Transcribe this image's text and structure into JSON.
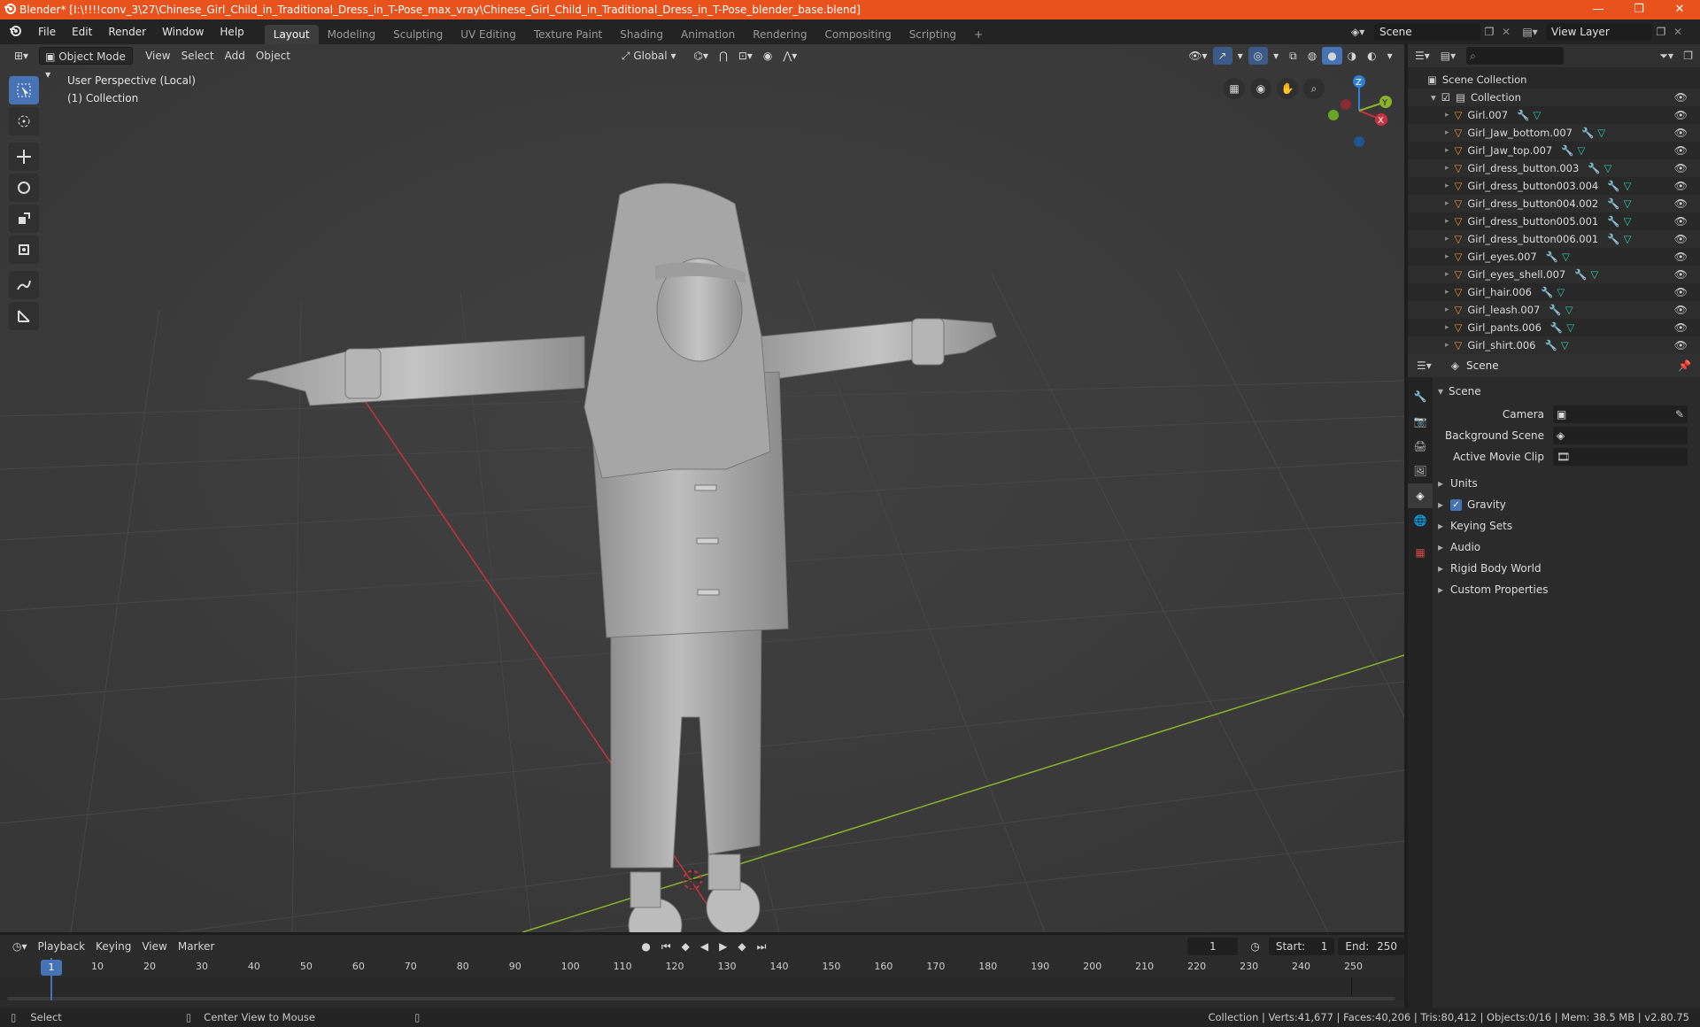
{
  "window": {
    "title": "Blender* [I:\\!!!!conv_3\\27\\Chinese_Girl_Child_in_Traditional_Dress_in_T-Pose_max_vray\\Chinese_Girl_Child_in_Traditional_Dress_in_T-Pose_blender_base.blend]",
    "minimize": "—",
    "maximize": "❐",
    "close": "✕"
  },
  "menubar": {
    "items": [
      "File",
      "Edit",
      "Render",
      "Window",
      "Help"
    ],
    "workspaces": [
      "Layout",
      "Modeling",
      "Sculpting",
      "UV Editing",
      "Texture Paint",
      "Shading",
      "Animation",
      "Rendering",
      "Compositing",
      "Scripting"
    ],
    "add_tab": "+",
    "scene_label": "Scene",
    "view_layer_label": "View Layer"
  },
  "viewport": {
    "mode": "Object Mode",
    "menus": [
      "View",
      "Select",
      "Add",
      "Object"
    ],
    "transform_orientation": "Global",
    "overlay_line1": "User Perspective (Local)",
    "overlay_line2": "(1) Collection",
    "gizmo_axes": {
      "x": "X",
      "y": "Y",
      "z": "Z"
    }
  },
  "outliner": {
    "search_placeholder": "",
    "root": "Scene Collection",
    "collection": "Collection",
    "objects": [
      "Girl.007",
      "Girl_Jaw_bottom.007",
      "Girl_Jaw_top.007",
      "Girl_dress_button.003",
      "Girl_dress_button003.004",
      "Girl_dress_button004.002",
      "Girl_dress_button005.001",
      "Girl_dress_button006.001",
      "Girl_eyes.007",
      "Girl_eyes_shell.007",
      "Girl_hair.006",
      "Girl_leash.007",
      "Girl_pants.006",
      "Girl_shirt.006"
    ]
  },
  "properties": {
    "header": "Scene",
    "section": "Scene",
    "fields": [
      {
        "label": "Camera",
        "value": ""
      },
      {
        "label": "Background Scene",
        "value": ""
      },
      {
        "label": "Active Movie Clip",
        "value": ""
      }
    ],
    "panels": [
      "Units",
      "Gravity",
      "Keying Sets",
      "Audio",
      "Rigid Body World",
      "Custom Properties"
    ],
    "gravity_checked": true
  },
  "timeline": {
    "menus": [
      "Playback",
      "Keying",
      "View",
      "Marker"
    ],
    "current_frame": "1",
    "start_label": "Start:",
    "start_value": "1",
    "end_label": "End:",
    "end_value": "250",
    "ticks": [
      "1",
      "10",
      "20",
      "30",
      "40",
      "50",
      "60",
      "70",
      "80",
      "90",
      "100",
      "110",
      "120",
      "130",
      "140",
      "150",
      "160",
      "170",
      "180",
      "190",
      "200",
      "210",
      "220",
      "230",
      "240",
      "250"
    ]
  },
  "statusbar": {
    "left_action": "Select",
    "mid_action": "Center View to Mouse",
    "stats": "Collection | Verts:41,677 | Faces:40,206 | Tris:80,412 | Objects:0/16 | Mem: 38.5 MB | v2.80.75"
  },
  "colors": {
    "titlebar": "#e8521c",
    "accent": "#4772b3",
    "x_axis": "#c8323f",
    "y_axis": "#8bb22a",
    "z_axis": "#2f7fd6",
    "mesh_icon": "#e58e39",
    "modifier_icon": "#7fa7e8",
    "data_icon": "#29c9a6"
  }
}
